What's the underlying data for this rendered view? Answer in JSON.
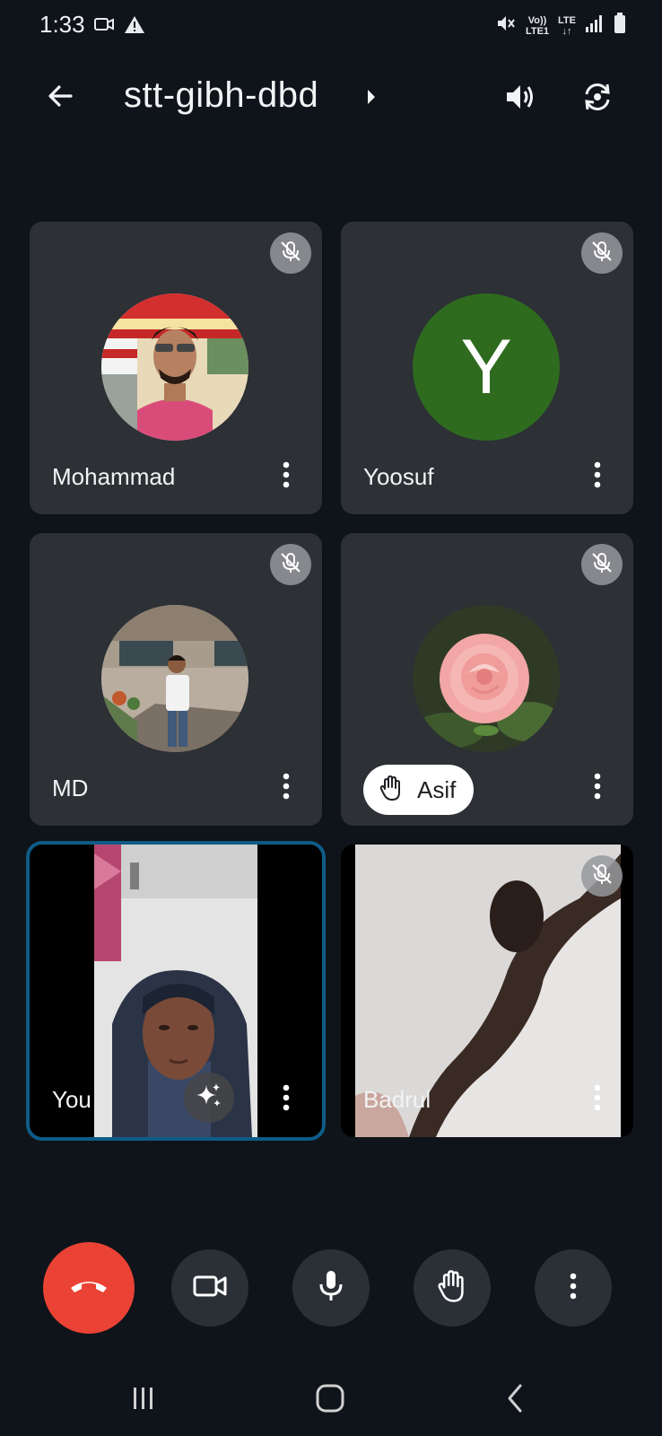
{
  "status_bar": {
    "time": "1:33",
    "icons": [
      "video-record-icon",
      "warning-icon",
      "mute-icon",
      "volte-icon",
      "lte-icon",
      "signal-icon",
      "battery-icon"
    ],
    "network_top": "Vo)) LTE",
    "network_bottom": "LTE1 ↓↑"
  },
  "header": {
    "meeting_code": "stt-gibh-dbd",
    "back_icon": "arrow-back-icon",
    "caret_icon": "caret-right-icon",
    "speaker_icon": "volume-icon",
    "switch_camera_icon": "camera-switch-icon"
  },
  "participants": [
    {
      "name": "Mohammad",
      "muted": true,
      "avatar": "photo"
    },
    {
      "name": "Yoosuf",
      "muted": true,
      "avatar": "letter",
      "initial": "Y",
      "avatar_color": "#2e6b1f"
    },
    {
      "name": "MD",
      "muted": true,
      "avatar": "photo"
    },
    {
      "name": "Asif",
      "muted": true,
      "avatar": "photo",
      "hand_raised": true
    },
    {
      "name": "You",
      "muted": false,
      "avatar": "video",
      "self": true
    },
    {
      "name": "Badrul",
      "muted": true,
      "avatar": "video"
    }
  ],
  "controls": {
    "end_call_icon": "call-end-icon",
    "camera_icon": "videocam-icon",
    "mic_icon": "mic-icon",
    "raise_hand_icon": "hand-icon",
    "more_icon": "more-vert-icon",
    "end_call_color": "#ea4335"
  },
  "nav": {
    "recents_icon": "recents-icon",
    "home_icon": "home-icon",
    "back_icon": "nav-back-icon"
  }
}
